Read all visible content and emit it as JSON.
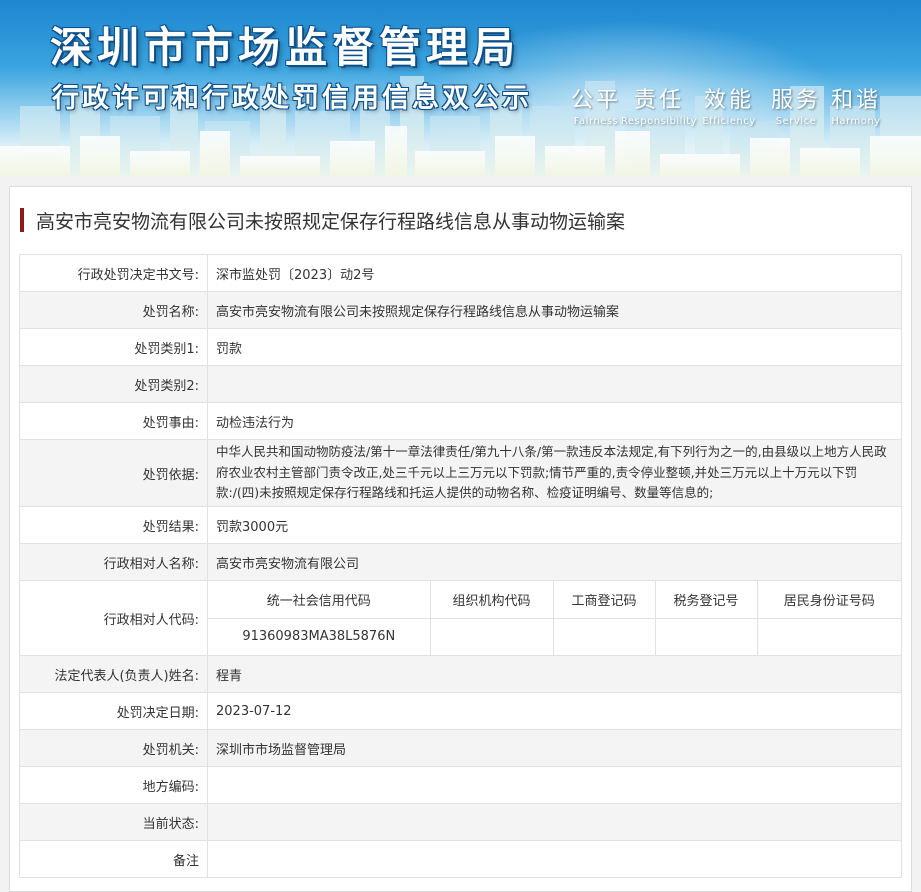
{
  "header": {
    "title": "深圳市市场监督管理局",
    "subtitle": "行政许可和行政处罚信用信息双公示",
    "slogan": [
      {
        "cn": "公平",
        "en": "Fairness"
      },
      {
        "cn": "责任",
        "en": "Responsibility"
      },
      {
        "cn": "效能",
        "en": "Efficiency"
      },
      {
        "cn": "服务",
        "en": "Service"
      },
      {
        "cn": "和谐",
        "en": "Harmony"
      }
    ]
  },
  "case": {
    "title": "高安市亮安物流有限公司未按照规定保存行程路线信息从事动物运输案"
  },
  "details": {
    "decision_no_label": "行政处罚决定书文号:",
    "decision_no": "深市监处罚〔2023〕动2号",
    "penalty_name_label": "处罚名称:",
    "penalty_name": "高安市亮安物流有限公司未按照规定保存行程路线信息从事动物运输案",
    "category1_label": "处罚类别1:",
    "category1": "罚款",
    "category2_label": "处罚类别2:",
    "category2": "",
    "reason_label": "处罚事由:",
    "reason": "动检违法行为",
    "basis_label": "处罚依据:",
    "basis": "中华人民共和国动物防疫法/第十一章法律责任/第九十八条/第一款违反本法规定,有下列行为之一的,由县级以上地方人民政府农业农村主管部门责令改正,处三千元以上三万元以下罚款;情节严重的,责令停业整顿,并处三万元以上十万元以下罚款:/(四)未按照规定保存行程路线和托运人提供的动物名称、检疫证明编号、数量等信息的;",
    "result_label": "处罚结果:",
    "result": "罚款3000元",
    "party_name_label": "行政相对人名称:",
    "party_name": "高安市亮安物流有限公司",
    "party_code_label": "行政相对人代码:",
    "code_headers": [
      "统一社会信用代码",
      "组织机构代码",
      "工商登记码",
      "税务登记号",
      "居民身份证号码"
    ],
    "code_values": [
      "91360983MA38L5876N",
      "",
      "",
      "",
      ""
    ],
    "legal_rep_label": "法定代表人(负责人)姓名:",
    "legal_rep": "程青",
    "decision_date_label": "处罚决定日期:",
    "decision_date": "2023-07-12",
    "authority_label": "处罚机关:",
    "authority": "深圳市市场监督管理局",
    "region_code_label": "地方编码:",
    "region_code": "",
    "status_label": "当前状态:",
    "status": "",
    "remarks_label": "备注",
    "remarks": ""
  },
  "colors": {
    "accent_bar": "#8b1a1a",
    "banner_blue": "#1d86cf",
    "row_alt": "#f4f4f4"
  }
}
